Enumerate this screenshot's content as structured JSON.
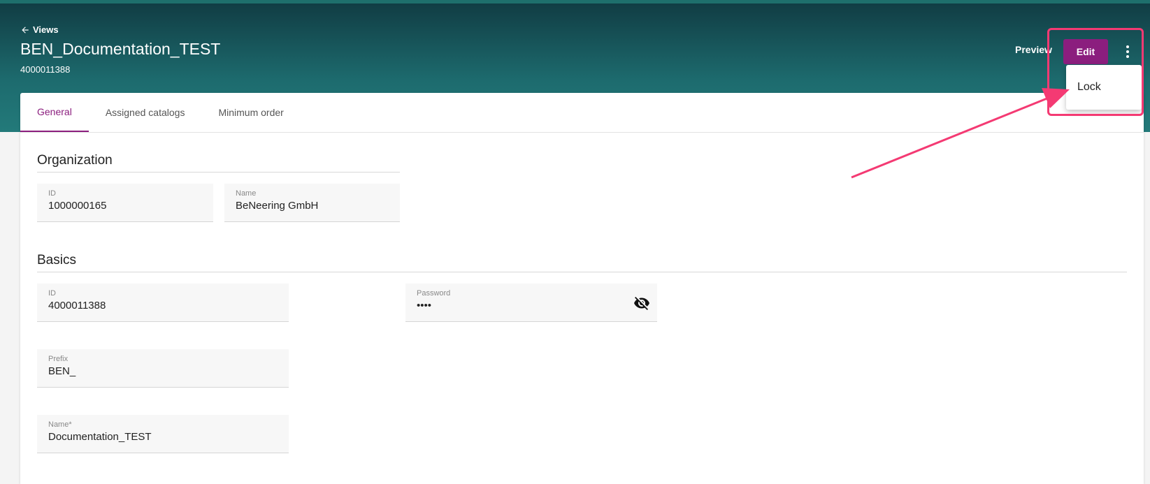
{
  "header": {
    "back_label": "Views",
    "title": "BEN_Documentation_TEST",
    "subtitle": "4000011388",
    "preview_label": "Preview",
    "edit_label": "Edit"
  },
  "menu": {
    "items": [
      {
        "label": "Lock"
      }
    ]
  },
  "tabs": [
    {
      "label": "General",
      "active": true
    },
    {
      "label": "Assigned catalogs",
      "active": false
    },
    {
      "label": "Minimum order",
      "active": false
    }
  ],
  "organization": {
    "title": "Organization",
    "id_label": "ID",
    "id_value": "1000000165",
    "name_label": "Name",
    "name_value": "BeNeering GmbH"
  },
  "basics": {
    "title": "Basics",
    "id_label": "ID",
    "id_value": "4000011388",
    "password_label": "Password",
    "password_value": "••••",
    "prefix_label": "Prefix",
    "prefix_value": "BEN_",
    "name_label": "Name*",
    "name_value": "Documentation_TEST"
  },
  "colors": {
    "accent": "#8b1e7e",
    "header_dark": "#113d44",
    "header_light": "#237a7a",
    "annotation": "#f43a73"
  },
  "icons": {
    "back": "arrow-left-icon",
    "more": "more-vert-icon",
    "password_toggle": "eye-off-icon"
  }
}
